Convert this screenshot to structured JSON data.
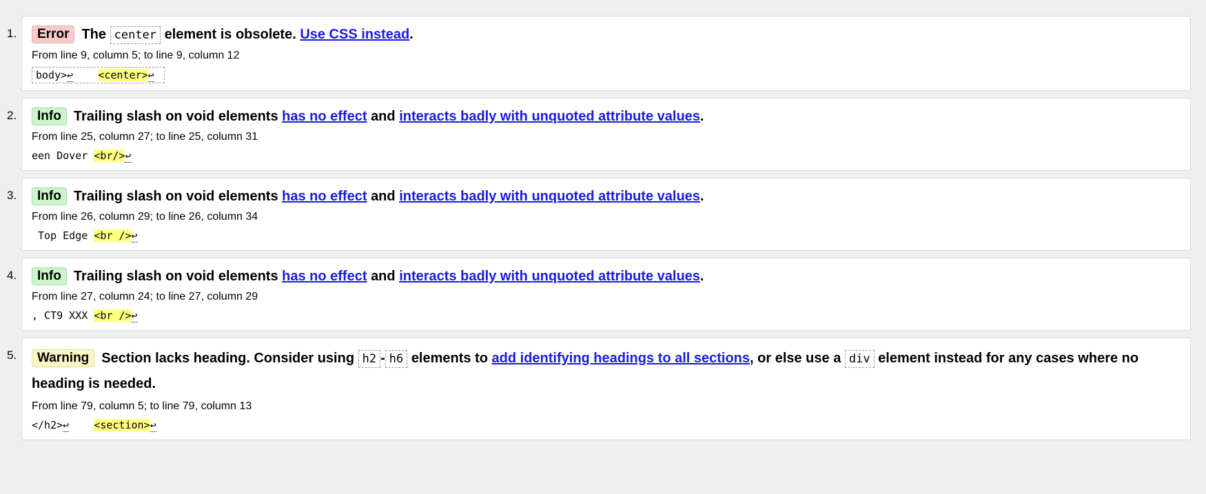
{
  "messages": [
    {
      "number": "1.",
      "type_label": "Error",
      "text_before": "The",
      "code1": "center",
      "text_mid": "element is obsolete.",
      "link1": "Use CSS instead",
      "text_end": ".",
      "location": "From line 9, column 5; to line 9, column 12",
      "extract_before": "body>",
      "extract_gap": "    ",
      "extract_highlight": "<center>",
      "linefeed": "↩"
    },
    {
      "number": "2.",
      "type_label": "Info",
      "text_before": "Trailing slash on void elements",
      "link1": "has no effect",
      "text_mid": "and",
      "link2": "interacts badly with unquoted attribute values",
      "text_end": ".",
      "location": "From line 25, column 27; to line 25, column 31",
      "extract_before": "een Dover ",
      "extract_highlight": "<br/>",
      "linefeed": "↩"
    },
    {
      "number": "3.",
      "type_label": "Info",
      "text_before": "Trailing slash on void elements",
      "link1": "has no effect",
      "text_mid": "and",
      "link2": "interacts badly with unquoted attribute values",
      "text_end": ".",
      "location": "From line 26, column 29; to line 26, column 34",
      "extract_before": " Top Edge ",
      "extract_highlight": "<br />",
      "linefeed": "↩"
    },
    {
      "number": "4.",
      "type_label": "Info",
      "text_before": "Trailing slash on void elements",
      "link1": "has no effect",
      "text_mid": "and",
      "link2": "interacts badly with unquoted attribute values",
      "text_end": ".",
      "location": "From line 27, column 24; to line 27, column 29",
      "extract_before": ", CT9 XXX ",
      "extract_highlight": "<br />",
      "linefeed": "↩"
    },
    {
      "number": "5.",
      "type_label": "Warning",
      "text_before": "Section lacks heading. Consider using",
      "code1": "h2",
      "dash": "-",
      "code2": "h6",
      "text_mid": "elements to",
      "link1": "add identifying headings to all sections",
      "text_mid2": ", or else use a",
      "code3": "div",
      "text_end": "element instead for any cases where no heading is needed.",
      "location": "From line 79, column 5; to line 79, column 13",
      "extract_before": "</h2>",
      "extract_gap": "    ",
      "extract_highlight": "<section>",
      "linefeed": "↩"
    }
  ],
  "colors": {
    "error_badge": "#f8cccc",
    "info_badge": "#ccf5cc",
    "warning_badge": "#fbf6c6",
    "link": "#1a1ae6",
    "highlight": "#ffff80"
  }
}
